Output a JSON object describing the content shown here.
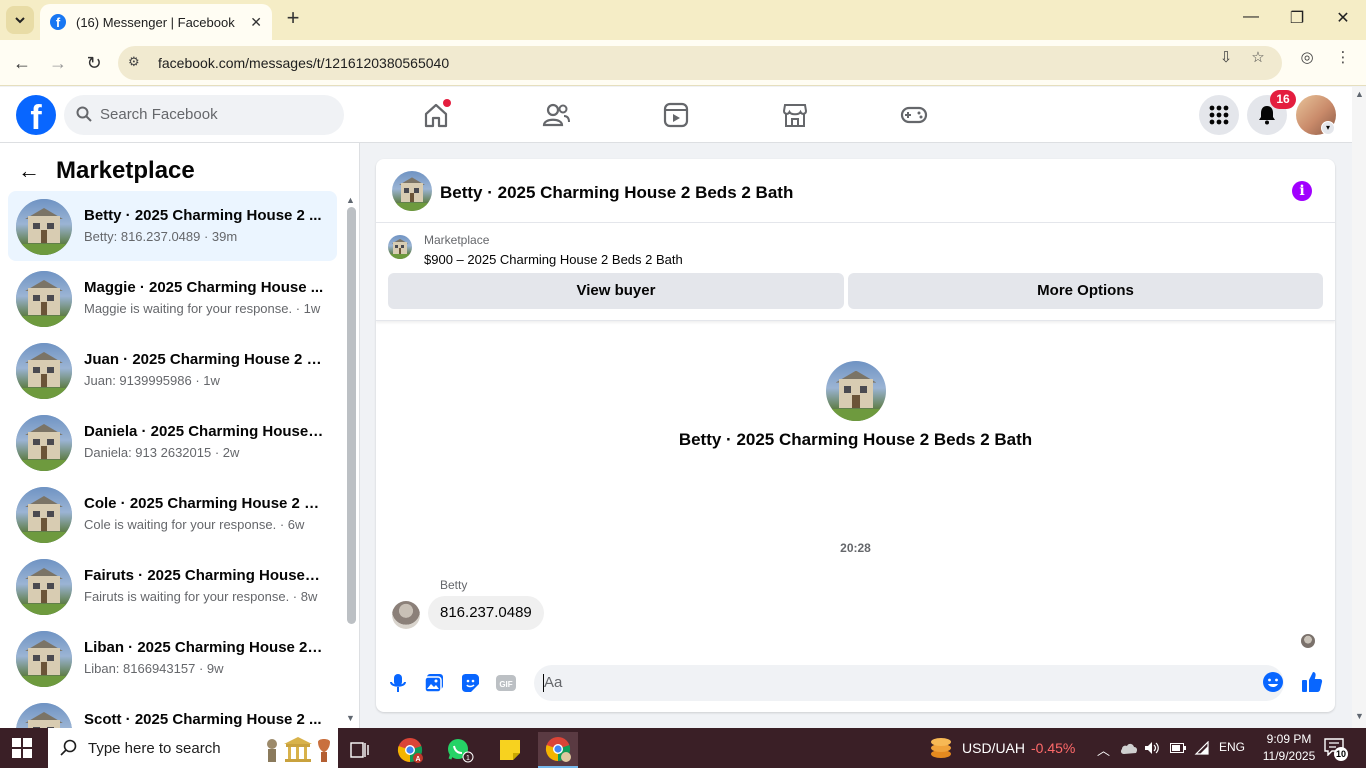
{
  "browser": {
    "tab_title": "(16) Messenger | Facebook",
    "url": "facebook.com/messages/t/1216120380565040"
  },
  "header": {
    "search_placeholder": "Search Facebook",
    "notification_count": "16"
  },
  "sidebar": {
    "title": "Marketplace",
    "conversations": [
      {
        "name": "Betty · 2025 Charming House 2 ...",
        "preview": "Betty: 816.237.0489 · 39m",
        "active": true
      },
      {
        "name": "Maggie · 2025 Charming House ...",
        "preview": "Maggie is waiting for your response. · 1w",
        "active": false
      },
      {
        "name": "Juan · 2025 Charming House 2 B...",
        "preview": "Juan: 9139995986 · 1w",
        "active": false
      },
      {
        "name": "Daniela · 2025 Charming House ...",
        "preview": "Daniela: 913 2632015 · 2w",
        "active": false
      },
      {
        "name": "Cole · 2025 Charming House 2 B...",
        "preview": "Cole is waiting for your response. · 6w",
        "active": false
      },
      {
        "name": "Fairuts · 2025 Charming House 2...",
        "preview": "Fairuts is waiting for your response. · 8w",
        "active": false
      },
      {
        "name": "Liban · 2025 Charming House 2 ...",
        "preview": "Liban: 8166943157 · 9w",
        "active": false
      },
      {
        "name": "Scott · 2025 Charming House 2 ...",
        "preview": "",
        "active": false
      }
    ]
  },
  "chat": {
    "title": "Betty · 2025 Charming House 2 Beds 2 Bath",
    "marketplace_label": "Marketplace",
    "listing": "$900 – 2025 Charming House 2 Beds 2 Bath",
    "view_buyer_label": "View buyer",
    "more_options_label": "More Options",
    "intro_name": "Betty · 2025 Charming House 2 Beds 2 Bath",
    "timestamp": "20:28",
    "sender": "Betty",
    "message": "816.237.0489",
    "composer_placeholder": "Aa",
    "accent_color": "#0866ff"
  },
  "taskbar": {
    "search_placeholder": "Type here to search",
    "ticker_label": "USD/UAH",
    "ticker_change": "-0.45%",
    "language": "ENG",
    "time": "9:09 PM",
    "date": "11/9/2025",
    "notification_count": "10"
  }
}
